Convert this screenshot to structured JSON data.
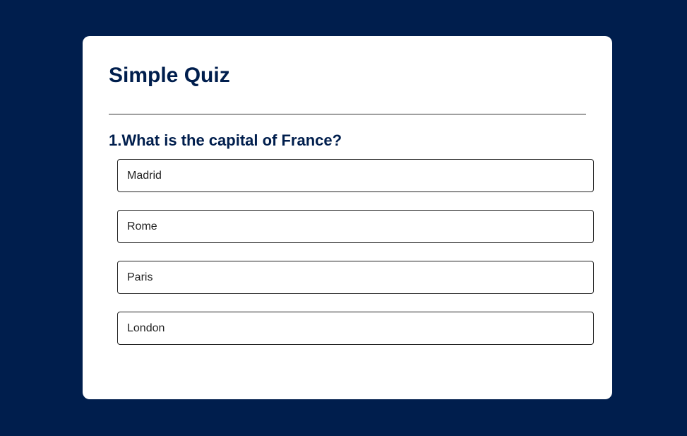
{
  "quiz": {
    "title": "Simple Quiz",
    "question": "1.What is the capital of France?",
    "answers": [
      {
        "label": "Madrid"
      },
      {
        "label": "Rome"
      },
      {
        "label": "Paris"
      },
      {
        "label": "London"
      }
    ]
  },
  "colors": {
    "background": "#001e4d",
    "card": "#ffffff",
    "heading": "#001e4d",
    "button_border": "#222222"
  }
}
